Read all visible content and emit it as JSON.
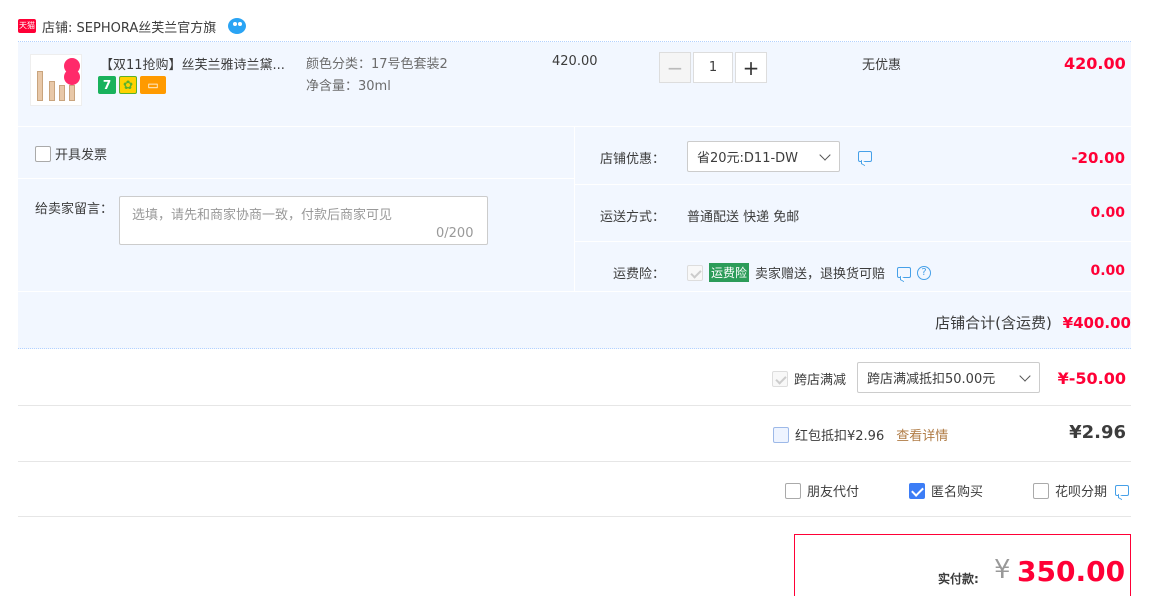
{
  "shop": {
    "tmall_label": "天猫",
    "name": "店铺: SEPHORA丝芙兰官方旗"
  },
  "item": {
    "title": "【双11抢购】丝芙兰雅诗兰黛...",
    "sku_color": "颜色分类：17号色套装2",
    "sku_volume": "净含量：30ml",
    "unit_price": "420.00",
    "quantity": "1",
    "discount": "无优惠",
    "subtotal": "420.00",
    "service_icons": [
      "seven-day-return-icon",
      "flower-icon",
      "credit-card-icon"
    ],
    "service_seven": "7"
  },
  "options": {
    "invoice_label": "开具发票",
    "message_label": "给卖家留言：",
    "message_placeholder": "选填，请先和商家协商一致，付款后商家可见",
    "message_count": "0/200",
    "shop_discount_label": "店铺优惠：",
    "shop_discount_value": "省20元:D11-DW",
    "shop_discount_amount": "-20.00",
    "shipping_label": "运送方式：",
    "shipping_value": "普通配送 快递 免邮",
    "shipping_amount": "0.00",
    "insurance_label": "运费险：",
    "insurance_tag": "运费险",
    "insurance_text": "卖家赠送，退换货可赔",
    "insurance_amount": "0.00",
    "help_glyph": "?"
  },
  "shop_total": {
    "label": "店铺合计(含运费)",
    "value": "¥400.00"
  },
  "cross_store": {
    "label": "跨店满减",
    "select_value": "跨店满减抵扣50.00元",
    "amount": "¥-50.00"
  },
  "red_packet": {
    "label": "红包抵扣¥2.96",
    "detail_link": "查看详情",
    "amount": "¥2.96"
  },
  "pay_options": {
    "friend_pay": "朋友代付",
    "anonymous": "匿名购买",
    "huabei": "花呗分期"
  },
  "payment": {
    "label": "实付款:",
    "currency": "¥",
    "amount": "350.00"
  },
  "colors": {
    "accent_red": "#ff0036",
    "light_blue_bg": "#f2f7ff",
    "check_blue": "#3c7df6"
  }
}
